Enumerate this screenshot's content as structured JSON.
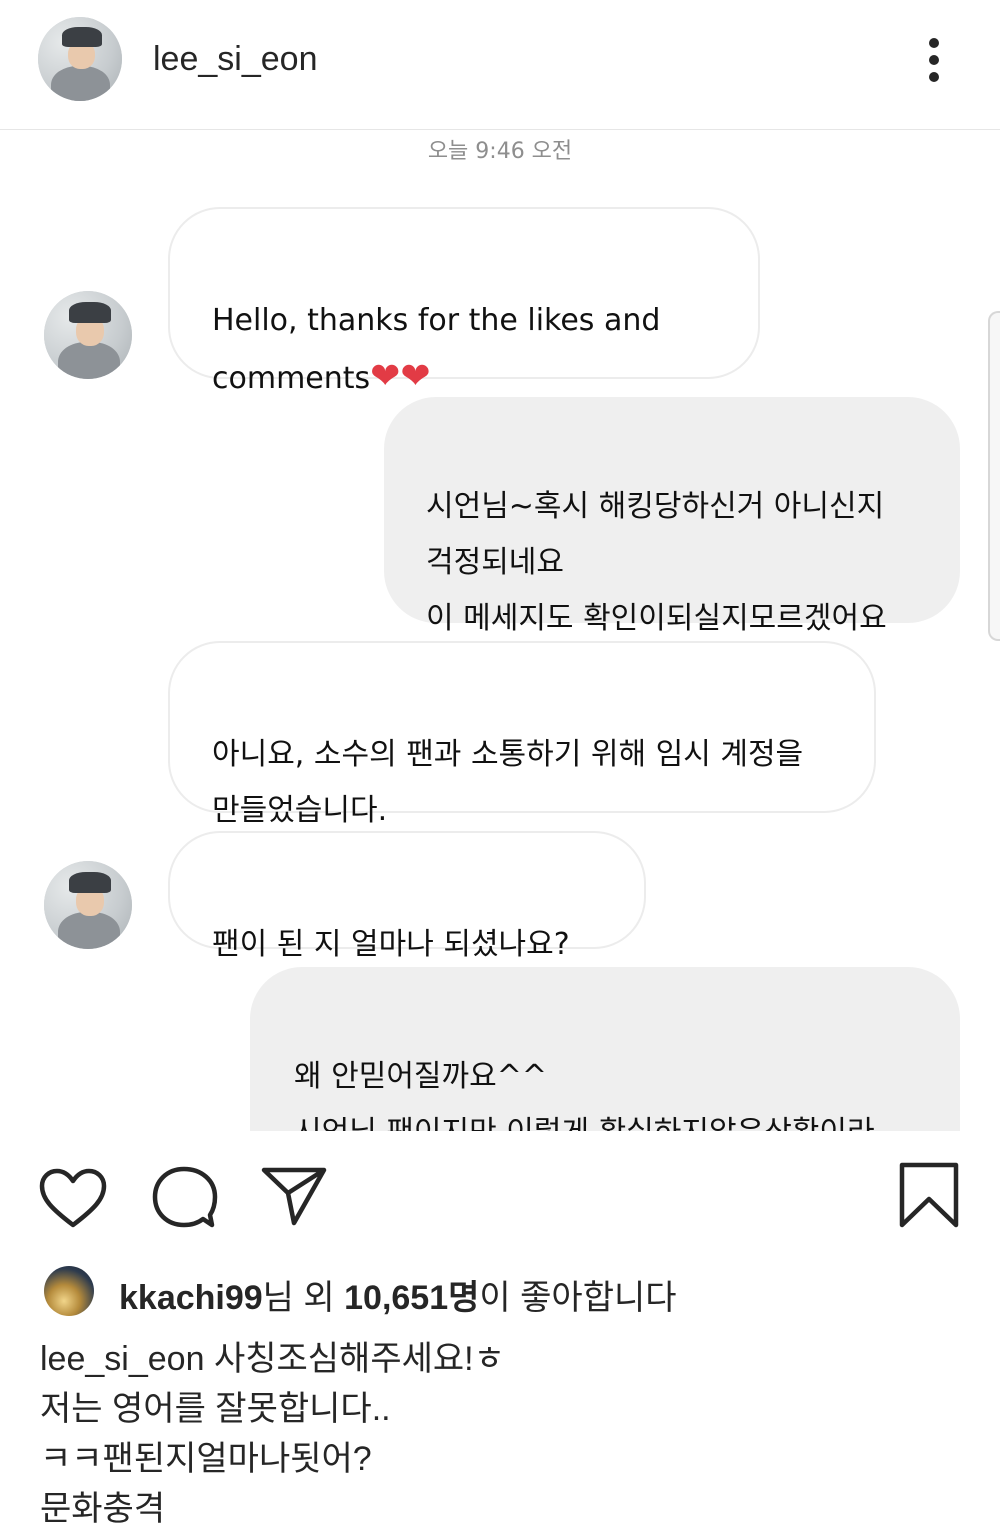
{
  "header": {
    "username": "lee_si_eon",
    "more_icon": "more-vertical-icon"
  },
  "chat": {
    "timestamp": "오늘 9:46 오전",
    "messages": [
      {
        "direction": "incoming",
        "text": "Hello, thanks for the likes and\ncomments",
        "emoji": "❤❤"
      },
      {
        "direction": "outgoing",
        "text": "시언님~혹시 해킹당하신거 아니신지\n걱정되네요\n이 메세지도 확인이되실지모르겠어요"
      },
      {
        "direction": "incoming",
        "text": "아니요, 소수의 팬과 소통하기 위해 임시 계정을\n만들었습니다."
      },
      {
        "direction": "incoming",
        "text": "팬이 된 지 얼마나 되셨나요?"
      },
      {
        "direction": "outgoing",
        "text": "왜 안믿어질까요^^\n시언님 팬이지만 이렇게 확실하지않은상황이라\n소통을 거절하겠습니다"
      }
    ],
    "heart_color": "#e23b45"
  },
  "actions": {
    "like_icon": "heart-icon",
    "comment_icon": "comment-icon",
    "share_icon": "send-icon",
    "save_icon": "bookmark-icon"
  },
  "likes": {
    "liker": "kkachi99",
    "suffix_1": "님 외 ",
    "count": "10,651명",
    "suffix_2": "이 좋아합니다"
  },
  "caption": {
    "username": "lee_si_eon",
    "lines": [
      "사칭조심해주세요!ㅎ",
      "저는 영어를 잘못합니다..",
      "ㅋㅋ팬된지얼마나됫어?",
      "문화충격"
    ]
  }
}
